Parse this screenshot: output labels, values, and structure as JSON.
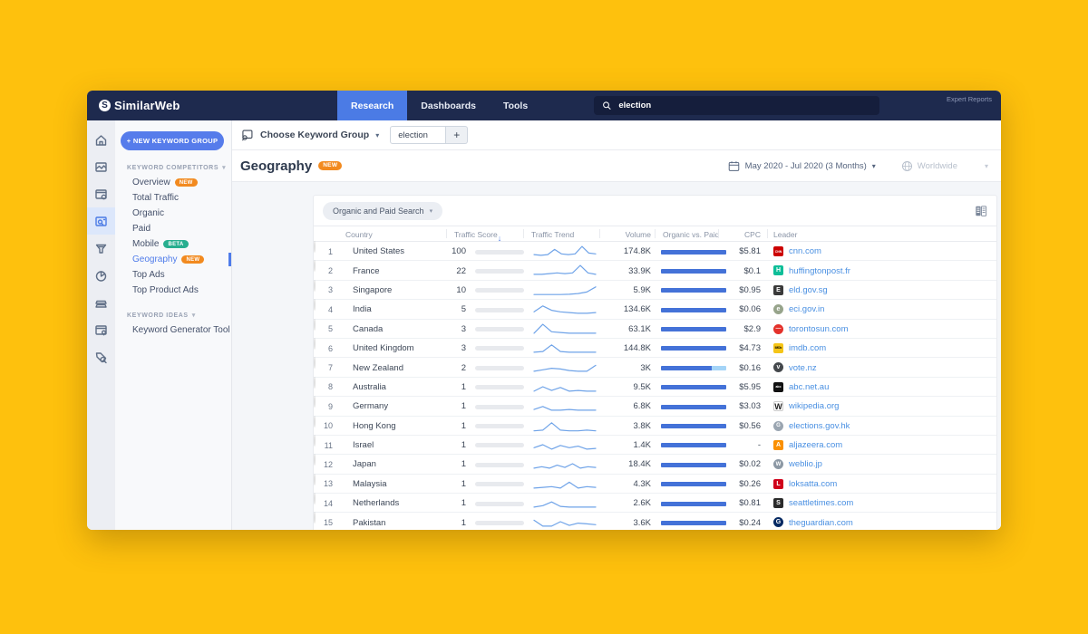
{
  "navbar": {
    "logo_text": "SimilarWeb",
    "logo_mark": "S",
    "tabs": [
      {
        "label": "Research",
        "active": true
      },
      {
        "label": "Dashboards",
        "active": false
      },
      {
        "label": "Tools",
        "active": false
      }
    ],
    "search": {
      "icon": "search-icon",
      "value": "election"
    },
    "expert_reports": "Expert Reports"
  },
  "sidebar": {
    "rail_icons": [
      {
        "name": "home-icon",
        "active": false
      },
      {
        "name": "website-analysis-icon",
        "active": false
      },
      {
        "name": "app-analysis-icon",
        "active": false
      },
      {
        "name": "keyword-analysis-icon",
        "active": true
      },
      {
        "name": "conversion-funnel-icon",
        "active": false
      },
      {
        "name": "market-share-icon",
        "active": false
      },
      {
        "name": "apps-trays-icon",
        "active": false
      },
      {
        "name": "app-store-icon",
        "active": false
      },
      {
        "name": "tag-search-icon",
        "active": false
      }
    ],
    "new_group_button": "+ NEW KEYWORD GROUP",
    "sections": [
      {
        "title": "KEYWORD COMPETITORS",
        "items": [
          {
            "label": "Overview",
            "badge": "NEW",
            "badge_type": "new",
            "active": false
          },
          {
            "label": "Total Traffic",
            "active": false
          },
          {
            "label": "Organic",
            "active": false
          },
          {
            "label": "Paid",
            "active": false
          },
          {
            "label": "Mobile",
            "badge": "BETA",
            "badge_type": "beta",
            "active": false
          },
          {
            "label": "Geography",
            "badge": "NEW",
            "badge_type": "new",
            "active": true
          },
          {
            "label": "Top Ads",
            "active": false
          },
          {
            "label": "Top Product Ads",
            "active": false
          }
        ]
      },
      {
        "title": "KEYWORD IDEAS",
        "items": [
          {
            "label": "Keyword Generator Tool",
            "active": false
          }
        ]
      }
    ]
  },
  "header": {
    "keyword_group_label": "Choose Keyword Group",
    "keyword_chip": "election",
    "add_button": "+",
    "page_title": "Geography",
    "new_badge": "NEW",
    "date_range": "May 2020 - Jul 2020 (3 Months)",
    "region": "Worldwide"
  },
  "table": {
    "filter_label": "Organic and Paid Search",
    "export_icon": "excel-export-icon",
    "columns": [
      "Country",
      "Traffic Score",
      "Traffic Trend",
      "Volume",
      "Organic vs. Paid",
      "CPC",
      "Leader"
    ],
    "sorted_column": "Traffic Score",
    "rows": [
      {
        "rank": 1,
        "country": "United States",
        "flag": {
          "t": "h",
          "c": [
            "#B22234",
            "#FFFFFF",
            "#B22234",
            "#FFFFFF",
            "#B22234"
          ],
          "canton": "#3C3B6E"
        },
        "score": 100,
        "trend": [
          1.5,
          1,
          1.5,
          5,
          2,
          1.5,
          2,
          7,
          2.5,
          2
        ],
        "volume": "174.8K",
        "organic_pct": 100,
        "cpc": "$5.81",
        "leader": "cnn.com",
        "favicon": {
          "shape": "square",
          "bg": "#CC0000",
          "fg": "#FFFFFF",
          "text": "CNN",
          "fs": 3.5
        }
      },
      {
        "rank": 2,
        "country": "France",
        "flag": {
          "t": "v",
          "c": [
            "#0055A4",
            "#FFFFFF",
            "#EF4135"
          ]
        },
        "score": 22,
        "trend": [
          1,
          1,
          1.5,
          2,
          1.5,
          2,
          7,
          2,
          1
        ],
        "volume": "33.9K",
        "organic_pct": 100,
        "cpc": "$0.1",
        "leader": "huffingtonpost.fr",
        "favicon": {
          "shape": "square",
          "bg": "#0DBE98",
          "fg": "#FFFFFF",
          "text": "H",
          "fs": 7
        }
      },
      {
        "rank": 3,
        "country": "Singapore",
        "flag": {
          "t": "h",
          "c": [
            "#EF3340",
            "#FFFFFF"
          ]
        },
        "score": 10,
        "trend": [
          0.8,
          0.8,
          0.8,
          0.8,
          1,
          1.5,
          2.5,
          6
        ],
        "volume": "5.9K",
        "organic_pct": 100,
        "cpc": "$0.95",
        "leader": "eld.gov.sg",
        "favicon": {
          "shape": "square",
          "bg": "#3A3A3A",
          "fg": "#FFFFFF",
          "text": "E",
          "fs": 7
        }
      },
      {
        "rank": 4,
        "country": "India",
        "flag": {
          "t": "h",
          "c": [
            "#FF9933",
            "#FFFFFF",
            "#138808"
          ]
        },
        "score": 5,
        "trend": [
          2,
          6,
          3,
          2,
          1.5,
          1,
          1,
          1.5
        ],
        "volume": "134.6K",
        "organic_pct": 100,
        "cpc": "$0.06",
        "leader": "eci.gov.in",
        "favicon": {
          "shape": "circle",
          "bg": "#97A48B",
          "fg": "#FFFFFF",
          "text": "e",
          "fs": 7
        }
      },
      {
        "rank": 5,
        "country": "Canada",
        "flag": {
          "t": "v",
          "c": [
            "#EF3340",
            "#FFFFFF",
            "#EF3340"
          ]
        },
        "score": 3,
        "trend": [
          1,
          7,
          2,
          1.5,
          1,
          1,
          1,
          1
        ],
        "volume": "63.1K",
        "organic_pct": 100,
        "cpc": "$2.9",
        "leader": "torontosun.com",
        "favicon": {
          "shape": "circle",
          "bg": "#E4322B",
          "fg": "#FFFFFF",
          "text": "—",
          "fs": 6
        }
      },
      {
        "rank": 6,
        "country": "United Kingdom",
        "flag": {
          "t": "uk",
          "c": [
            "#26418F",
            "#FFFFFF",
            "#CF142B"
          ]
        },
        "score": 3,
        "trend": [
          1,
          1.5,
          6,
          1.5,
          1,
          1,
          1,
          1
        ],
        "volume": "144.8K",
        "organic_pct": 100,
        "cpc": "$4.73",
        "leader": "imdb.com",
        "favicon": {
          "shape": "square",
          "bg": "#F5C518",
          "fg": "#000000",
          "text": "IMDb",
          "fs": 3.2
        }
      },
      {
        "rank": 7,
        "country": "New Zealand",
        "flag": {
          "t": "solid",
          "c": [
            "#26418F"
          ]
        },
        "score": 2,
        "trend": [
          1,
          2,
          3,
          2.5,
          1.5,
          1,
          1,
          5
        ],
        "volume": "3K",
        "organic_pct": 78,
        "cpc": "$0.16",
        "leader": "vote.nz",
        "favicon": {
          "shape": "circle",
          "bg": "#44484C",
          "fg": "#FFFFFF",
          "text": "v",
          "fs": 7
        }
      },
      {
        "rank": 8,
        "country": "Australia",
        "flag": {
          "t": "solid",
          "c": [
            "#26418F"
          ]
        },
        "score": 1,
        "trend": [
          1,
          4,
          1.5,
          3.5,
          1,
          1.5,
          1,
          1
        ],
        "volume": "9.5K",
        "organic_pct": 100,
        "cpc": "$5.95",
        "leader": "abc.net.au",
        "favicon": {
          "shape": "square",
          "bg": "#111111",
          "fg": "#FFFFFF",
          "text": "abc",
          "fs": 3.5
        }
      },
      {
        "rank": 9,
        "country": "Germany",
        "flag": {
          "t": "h",
          "c": [
            "#000000",
            "#DD0000",
            "#FFCE00"
          ]
        },
        "score": 1,
        "trend": [
          1.5,
          3.5,
          1,
          1,
          1.5,
          1,
          1,
          1
        ],
        "volume": "6.8K",
        "organic_pct": 100,
        "cpc": "$3.03",
        "leader": "wikipedia.org",
        "favicon": {
          "shape": "square",
          "bg": "#FFFFFF",
          "fg": "#222222",
          "text": "W",
          "fs": 9
        }
      },
      {
        "rank": 10,
        "country": "Hong Kong",
        "flag": {
          "t": "dot",
          "c": [
            "#DE2910",
            "#FFFFFF"
          ]
        },
        "score": 1,
        "trend": [
          0.5,
          1,
          6,
          1,
          0.5,
          0.5,
          1,
          0.5
        ],
        "volume": "3.8K",
        "organic_pct": 100,
        "cpc": "$0.56",
        "leader": "elections.gov.hk",
        "favicon": {
          "shape": "circle",
          "bg": "#9AA5B1",
          "fg": "#FFFFFF",
          "text": "G",
          "fs": 6
        }
      },
      {
        "rank": 11,
        "country": "Israel",
        "flag": {
          "t": "h",
          "c": [
            "#FFFFFF",
            "#0038B8",
            "#FFFFFF",
            "#0038B8",
            "#FFFFFF"
          ]
        },
        "score": 1,
        "trend": [
          2,
          4,
          1,
          3.5,
          2,
          3,
          1,
          1.5
        ],
        "volume": "1.4K",
        "organic_pct": 100,
        "cpc": "-",
        "leader": "aljazeera.com",
        "favicon": {
          "shape": "square",
          "bg": "#FA9000",
          "fg": "#FFFFFF",
          "text": "A",
          "fs": 7
        }
      },
      {
        "rank": 12,
        "country": "Japan",
        "flag": {
          "t": "dot",
          "c": [
            "#FFFFFF",
            "#BC002D"
          ]
        },
        "score": 1,
        "trend": [
          1,
          2,
          1,
          3,
          1.5,
          4,
          1,
          2,
          1.5
        ],
        "volume": "18.4K",
        "organic_pct": 100,
        "cpc": "$0.02",
        "leader": "weblio.jp",
        "favicon": {
          "shape": "circle",
          "bg": "#8C98A4",
          "fg": "#FFFFFF",
          "text": "W",
          "fs": 6
        }
      },
      {
        "rank": 13,
        "country": "Malaysia",
        "flag": {
          "t": "h",
          "c": [
            "#CC0001",
            "#FFFFFF",
            "#CC0001",
            "#FFFFFF"
          ],
          "canton": "#010066"
        },
        "score": 1,
        "trend": [
          1,
          1.5,
          2,
          1,
          5,
          1,
          2,
          1.5
        ],
        "volume": "4.3K",
        "organic_pct": 100,
        "cpc": "$0.26",
        "leader": "loksatta.com",
        "favicon": {
          "shape": "square",
          "bg": "#D0021B",
          "fg": "#FFFFFF",
          "text": "L",
          "fs": 7
        }
      },
      {
        "rank": 14,
        "country": "Netherlands",
        "flag": {
          "t": "h",
          "c": [
            "#AE1C28",
            "#FFFFFF",
            "#21468B"
          ]
        },
        "score": 1,
        "trend": [
          1,
          2,
          4.5,
          1.5,
          1,
          1,
          1,
          1
        ],
        "volume": "2.6K",
        "organic_pct": 100,
        "cpc": "$0.81",
        "leader": "seattletimes.com",
        "favicon": {
          "shape": "square",
          "bg": "#2B2B2B",
          "fg": "#FFFFFF",
          "text": "S",
          "fs": 7
        }
      },
      {
        "rank": 15,
        "country": "Pakistan",
        "flag": {
          "t": "v",
          "c": [
            "#FFFFFF",
            "#01411C",
            "#01411C"
          ]
        },
        "score": 1,
        "trend": [
          5,
          1,
          1,
          4,
          1.5,
          3,
          2.5,
          2
        ],
        "volume": "3.6K",
        "organic_pct": 100,
        "cpc": "$0.24",
        "leader": "theguardian.com",
        "favicon": {
          "shape": "circle",
          "bg": "#052962",
          "fg": "#FFFFFF",
          "text": "G",
          "fs": 7
        }
      }
    ]
  },
  "colors": {
    "background": "#FEC10D",
    "navbar": "#1E2A4E",
    "accent_blue": "#4B7BE5",
    "bar_dark": "#4472D8",
    "bar_light": "#A4D4F7",
    "sparkline": "#6FA3E8",
    "link": "#4A90E2",
    "badge_new": "#F28A1F",
    "badge_beta": "#27AE8F"
  }
}
